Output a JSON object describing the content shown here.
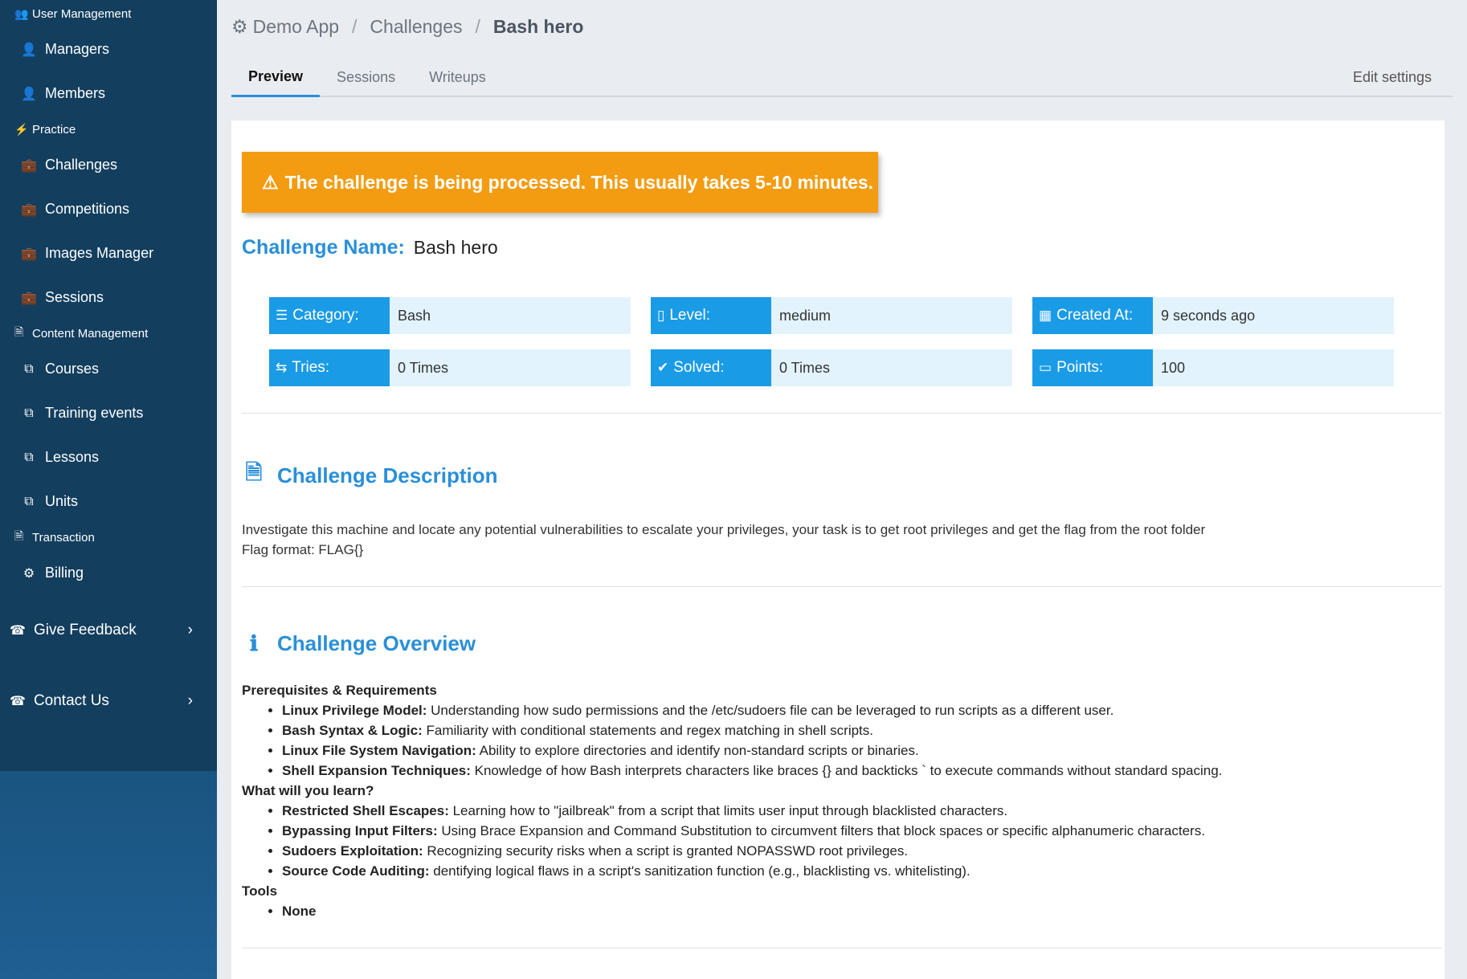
{
  "sidebar": {
    "user_management": "User Management",
    "managers": "Managers",
    "members": "Members",
    "practice": "Practice",
    "challenges": "Challenges",
    "competitions": "Competitions",
    "images_manager": "Images Manager",
    "sessions": "Sessions",
    "content_management": "Content Management",
    "courses": "Courses",
    "training_events": "Training events",
    "lessons": "Lessons",
    "units": "Units",
    "transaction": "Transaction",
    "billing": "Billing",
    "give_feedback": "Give Feedback",
    "contact_us": "Contact Us"
  },
  "breadcrumb": {
    "root": "Demo App",
    "section": "Challenges",
    "current": "Bash hero"
  },
  "tabs": {
    "preview": "Preview",
    "sessions": "Sessions",
    "writeups": "Writeups",
    "edit_settings": "Edit settings"
  },
  "alert": {
    "text": "The challenge is being processed. This usually takes 5-10 minutes."
  },
  "challenge": {
    "name_label": "Challenge Name:",
    "name": "Bash hero",
    "category_label": "Category:",
    "category": "Bash",
    "level_label": "Level:",
    "level": "medium",
    "created_label": "Created At:",
    "created": "9 seconds ago",
    "tries_label": "Tries:",
    "tries": "0 Times",
    "solved_label": "Solved:",
    "solved": "0 Times",
    "points_label": "Points:",
    "points": "100"
  },
  "description": {
    "title": "Challenge Description",
    "line1": "Investigate this machine and locate any potential vulnerabilities to escalate your privileges, your task is to get root privileges and get the flag from the root folder",
    "line2": "Flag format: FLAG{}"
  },
  "overview": {
    "title": "Challenge Overview",
    "prereq_heading": "Prerequisites & Requirements",
    "prereq": [
      {
        "term": "Linux Privilege Model:",
        "text": " Understanding how sudo permissions and the /etc/sudoers file can be leveraged to run scripts as a different user."
      },
      {
        "term": "Bash Syntax & Logic:",
        "text": " Familiarity with conditional statements and regex matching in shell scripts."
      },
      {
        "term": "Linux File System Navigation:",
        "text": " Ability to explore directories and identify non-standard scripts or binaries."
      },
      {
        "term": "Shell Expansion Techniques:",
        "text": " Knowledge of how Bash interprets characters like braces {} and backticks ` to execute commands without standard spacing."
      }
    ],
    "learn_heading": "What will you learn?",
    "learn": [
      {
        "term": "Restricted Shell Escapes:",
        "text": " Learning how to \"jailbreak\" from a script that limits user input through blacklisted characters."
      },
      {
        "term": "Bypassing Input Filters:",
        "text": " Using Brace Expansion and Command Substitution to circumvent filters that block spaces or specific alphanumeric characters."
      },
      {
        "term": "Sudoers Exploitation:",
        "text": " Recognizing security risks when a script is granted NOPASSWD root privileges."
      },
      {
        "term": "Source Code Auditing:",
        "text": " dentifying logical flaws in a script's sanitization function (e.g., blacklisting vs. whitelisting)."
      }
    ],
    "tools_heading": "Tools",
    "tools": "None"
  },
  "icons": {
    "user_management": "users-icon",
    "managers": "user-icon",
    "members": "user-icon",
    "practice": "bolt-icon",
    "briefcase": "briefcase-icon",
    "content": "document-icon",
    "copy": "copy-icon",
    "billing": "gears-icon",
    "phone": "phone-icon",
    "dashboard": "dashboard-icon",
    "warning": "warning-icon",
    "info": "info-icon"
  },
  "colors": {
    "accent": "#2a8fd8",
    "stat_key": "#1a9be6",
    "stat_value_bg": "#e3f3fd",
    "alert": "#f39c12",
    "sidebar": "#133e5e"
  }
}
